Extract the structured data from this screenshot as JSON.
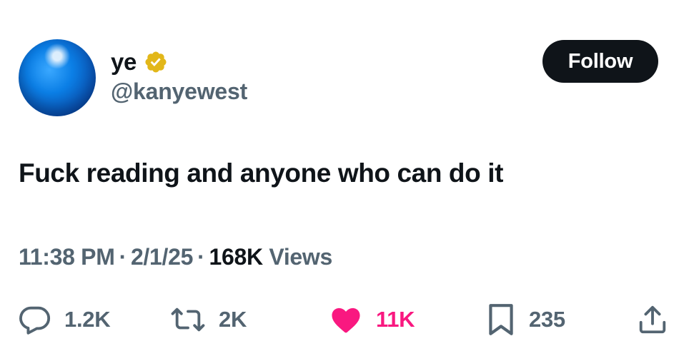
{
  "author": {
    "display_name": "ye",
    "handle": "@kanyewest",
    "verified": true,
    "verified_color": "#e2b719"
  },
  "follow_label": "Follow",
  "tweet": {
    "text": "Fuck reading and anyone who can do it"
  },
  "meta": {
    "time": "11:38 PM",
    "date": "2/1/25",
    "views_count": "168K",
    "views_label": "Views",
    "separator": "·"
  },
  "actions": {
    "replies": "1.2K",
    "reposts": "2K",
    "likes": "11K",
    "bookmarks": "235"
  },
  "colors": {
    "text_primary": "#0f1419",
    "text_secondary": "#536471",
    "like_active": "#f91880",
    "button_bg": "#0f1419"
  }
}
